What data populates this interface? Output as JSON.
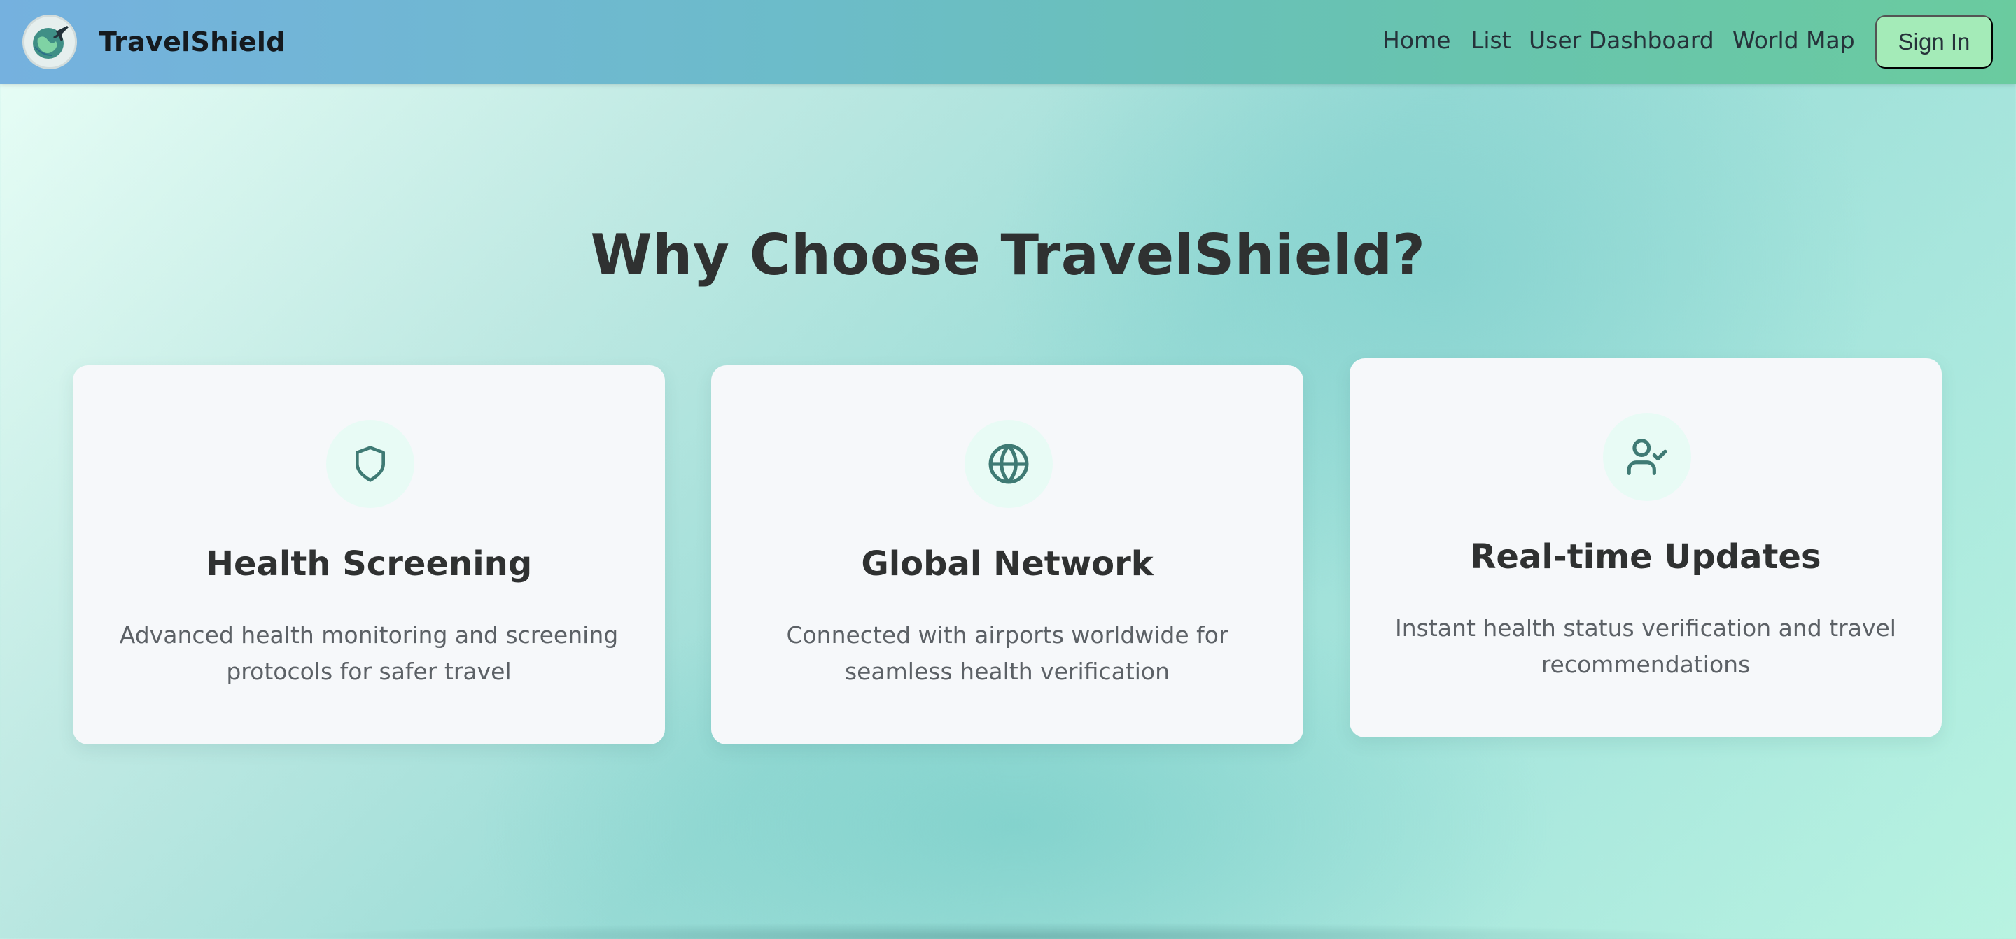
{
  "navbar": {
    "brand": "TravelShield",
    "links": [
      "Home",
      "List",
      "User Dashboard",
      "World Map"
    ],
    "signin_label": "Sign In"
  },
  "main": {
    "heading": "Why Choose TravelShield?",
    "cards": [
      {
        "icon": "shield-icon",
        "title": "Health Screening",
        "description": "Advanced health monitoring and screening protocols for safer travel"
      },
      {
        "icon": "globe-icon",
        "title": "Global Network",
        "description": "Connected with airports worldwide for seamless health verification"
      },
      {
        "icon": "user-check-icon",
        "title": "Real-time Updates",
        "description": "Instant health status verification and travel recommendations"
      }
    ]
  },
  "colors": {
    "accent": "#3f7a74",
    "signin_bg": "#a4ebb8",
    "card_bg": "#f6f8fa",
    "icon_circle_bg": "#e8fbf5"
  }
}
